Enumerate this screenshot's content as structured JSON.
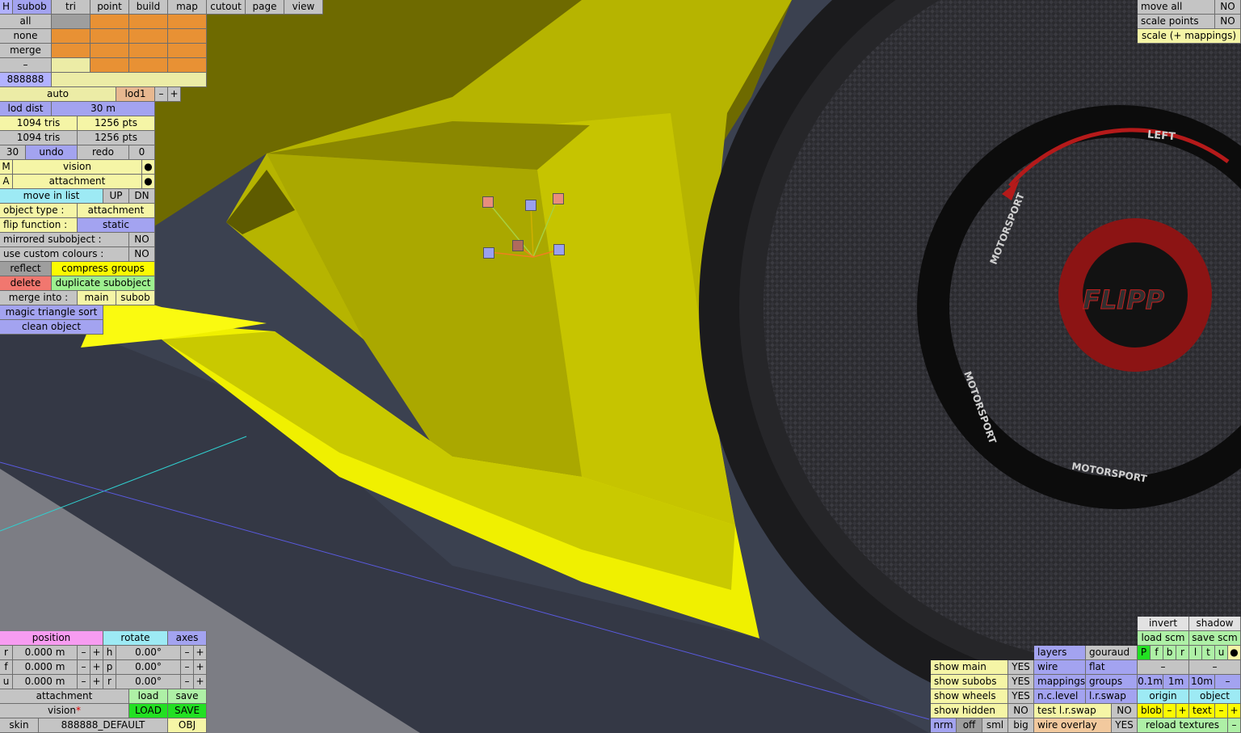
{
  "top_tabs": {
    "h": "H",
    "subob": "subob",
    "tri": "tri",
    "point": "point",
    "build": "build",
    "map": "map",
    "cutout": "cutout",
    "page": "page",
    "view": "view"
  },
  "select_rows": {
    "all": "all",
    "none": "none",
    "merge": "merge",
    "dash": "–",
    "code": "888888"
  },
  "lod": {
    "auto": "auto",
    "lod": "lod1",
    "minus": "–",
    "plus": "+",
    "dist_label": "lod dist",
    "dist_value": "30 m"
  },
  "stats": {
    "tris1": "1094 tris",
    "pts1": "1256 pts",
    "tris2": "1094 tris",
    "pts2": "1256 pts"
  },
  "history": {
    "count": "30",
    "undo": "undo",
    "redo": "redo",
    "zero": "0"
  },
  "props": {
    "m_key": "M",
    "m_val": "vision",
    "a_key": "A",
    "a_val": "attachment",
    "dot": "●",
    "move_in_list": "move in list",
    "up": "UP",
    "dn": "DN",
    "object_type_label": "object type :",
    "object_type": "attachment",
    "flip_label": "flip function :",
    "flip_value": "static",
    "mirrored_label": "mirrored subobject :",
    "mirrored_value": "NO",
    "custom_colours_label": "use custom colours :",
    "custom_colours_value": "NO",
    "reflect": "reflect",
    "compress": "compress groups",
    "delete": "delete",
    "duplicate": "duplicate subobject",
    "merge_into": "merge into :",
    "main": "main",
    "subob": "subob",
    "magic_sort": "magic triangle sort",
    "clean": "clean object"
  },
  "top_right": {
    "move_all": "move all",
    "move_all_val": "NO",
    "scale_points": "scale points",
    "scale_points_val": "NO",
    "scale_mappings": "scale (+ mappings)"
  },
  "transform": {
    "position": "position",
    "rotate": "rotate",
    "axes": "axes",
    "rows": [
      {
        "axis": "r",
        "pos": "0.000 m",
        "rot_axis": "h",
        "rot": "0.00°"
      },
      {
        "axis": "f",
        "pos": "0.000 m",
        "rot_axis": "p",
        "rot": "0.00°"
      },
      {
        "axis": "u",
        "pos": "0.000 m",
        "rot_axis": "r",
        "rot": "0.00°"
      }
    ],
    "minus": "–",
    "plus": "+",
    "attachment": "attachment",
    "load": "load",
    "save": "save",
    "vision": "vision",
    "star": "*",
    "LOAD": "LOAD",
    "SAVE": "SAVE",
    "skin": "skin",
    "skin_value": "888888_DEFAULT",
    "obj": "OBJ"
  },
  "view_opts": {
    "show_main": "show main",
    "show_subobs": "show subobs",
    "show_wheels": "show wheels",
    "show_hidden": "show hidden",
    "yes": "YES",
    "no": "NO",
    "nrm": "nrm",
    "off": "off",
    "sml": "sml",
    "big": "big",
    "layers": "layers",
    "gouraud": "gouraud",
    "wire": "wire",
    "flat": "flat",
    "mappings": "mappings",
    "groups": "groups",
    "nc_level": "n.c.level",
    "lr_swap": "l.r.swap",
    "test_lr_swap": "test l.r.swap",
    "wire_overlay": "wire overlay"
  },
  "right_panel": {
    "invert": "invert",
    "shadow": "shadow",
    "load_scm": "load scm",
    "save_scm": "save scm",
    "letters": [
      "P",
      "f",
      "b",
      "r",
      "l",
      "t",
      "u"
    ],
    "dot": "●",
    "dash": "–",
    "d01": "0.1m",
    "d1": "1m",
    "d10": "10m",
    "origin": "origin",
    "object": "object",
    "blob": "blob",
    "text": "text",
    "minus": "–",
    "plus": "+",
    "reload": "reload textures"
  },
  "tire_text": {
    "left": "LEFT",
    "motorsport": "MOTORSPORT",
    "logo": "FLIPP"
  },
  "colors": {
    "body_yellow": "#c8c800",
    "bright_yellow": "#f2f200",
    "tire": "#1c1c1c",
    "rim_red": "#a01818",
    "floor": "#3c4150"
  }
}
